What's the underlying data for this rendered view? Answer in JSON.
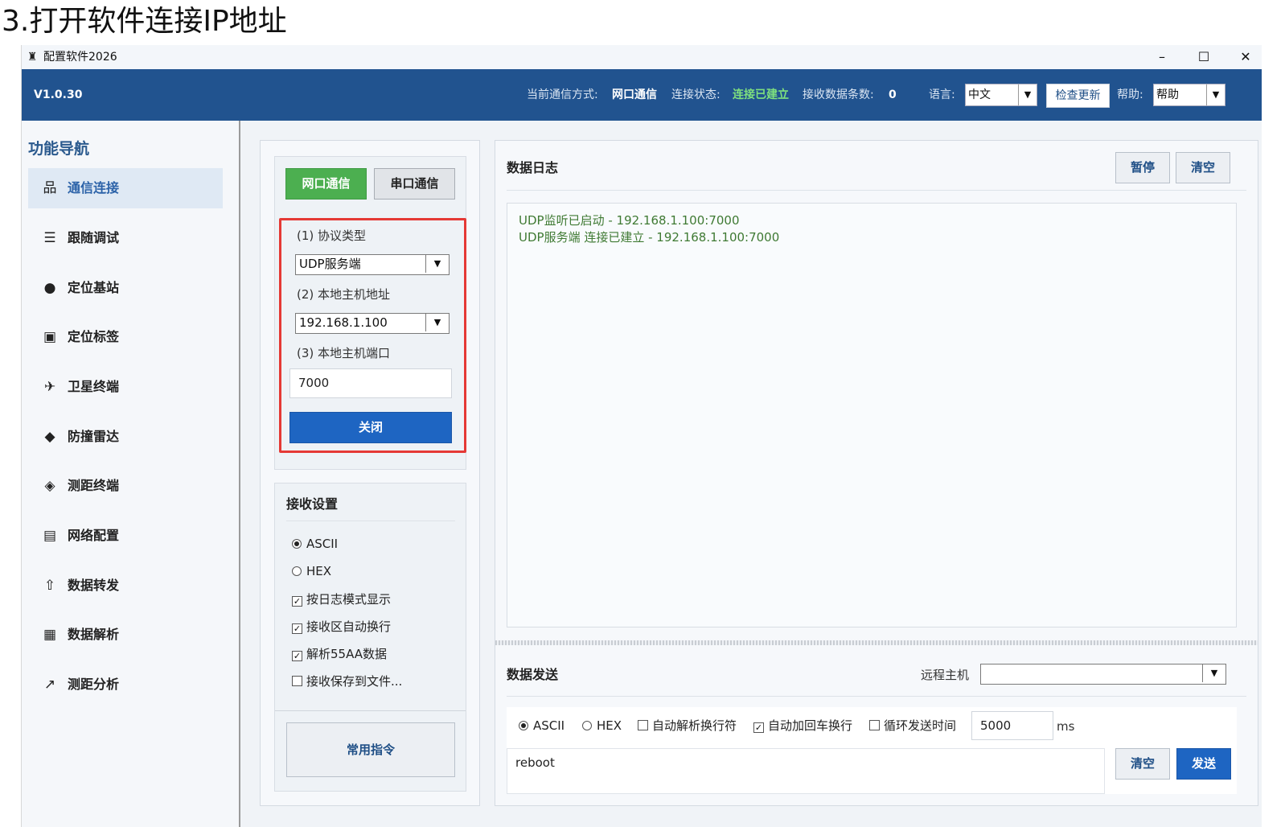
{
  "doc_heading": "3.打开软件连接IP地址",
  "window": {
    "title": "配置软件2026",
    "icon": "app-logo-icon"
  },
  "header": {
    "version": "V1.0.30",
    "comm_mode_label": "当前通信方式:",
    "comm_mode_value": "网口通信",
    "conn_status_label": "连接状态:",
    "conn_status_value": "连接已建立",
    "rx_count_label": "接收数据条数:",
    "rx_count_value": "0",
    "language_label": "语言:",
    "language_value": "中文",
    "check_update_label": "检查更新",
    "help_label": "帮助:",
    "help_value": "帮助",
    "status_color": "#7ee07e",
    "bar_color": "#21538f"
  },
  "sidebar": {
    "title": "功能导航",
    "items": [
      {
        "label": "通信连接",
        "icon": "network-icon",
        "glyph": "品"
      },
      {
        "label": "跟随调试",
        "icon": "follow-debug-icon",
        "glyph": "☰"
      },
      {
        "label": "定位基站",
        "icon": "location-pin-icon",
        "glyph": "●"
      },
      {
        "label": "定位标签",
        "icon": "tag-icon",
        "glyph": "▣"
      },
      {
        "label": "卫星终端",
        "icon": "satellite-icon",
        "glyph": "✈"
      },
      {
        "label": "防撞雷达",
        "icon": "shield-icon",
        "glyph": "◆"
      },
      {
        "label": "测距终端",
        "icon": "ruler-icon",
        "glyph": "◈"
      },
      {
        "label": "网络配置",
        "icon": "router-icon",
        "glyph": "▤"
      },
      {
        "label": "数据转发",
        "icon": "share-upload-icon",
        "glyph": "⇧"
      },
      {
        "label": "数据解析",
        "icon": "document-icon",
        "glyph": "▦"
      },
      {
        "label": "测距分析",
        "icon": "line-chart-icon",
        "glyph": "↗"
      }
    ]
  },
  "connection": {
    "tab_network": "网口通信",
    "tab_serial": "串口通信",
    "protocol_label": "(1) 协议类型",
    "protocol_value": "UDP服务端",
    "host_label": "(2) 本地主机地址",
    "host_value": "192.168.1.100",
    "port_label": "(3) 本地主机端口",
    "port_value": "7000",
    "close_button": "关闭"
  },
  "receive": {
    "title": "接收设置",
    "radio_ascii": "ASCII",
    "radio_hex": "HEX",
    "opt_log_mode": "按日志模式显示",
    "opt_auto_wrap": "接收区自动换行",
    "opt_parse_55aa": "解析55AA数据",
    "opt_save_file": "接收保存到文件...",
    "common_commands": "常用指令"
  },
  "log": {
    "title": "数据日志",
    "pause_button": "暂停",
    "clear_button": "清空",
    "lines": [
      "UDP监听已启动 - 192.168.1.100:7000",
      "UDP服务端 连接已建立 - 192.168.1.100:7000"
    ]
  },
  "send": {
    "title": "数据发送",
    "remote_host_label": "远程主机",
    "remote_host_value": "",
    "radio_ascii": "ASCII",
    "radio_hex": "HEX",
    "opt_parse_newline": "自动解析换行符",
    "opt_append_crlf": "自动加回车换行",
    "opt_loop_send": "循环发送时间",
    "interval_value": "5000",
    "interval_unit": "ms",
    "input_value": "reboot",
    "clear_button": "清空",
    "send_button": "发送"
  }
}
